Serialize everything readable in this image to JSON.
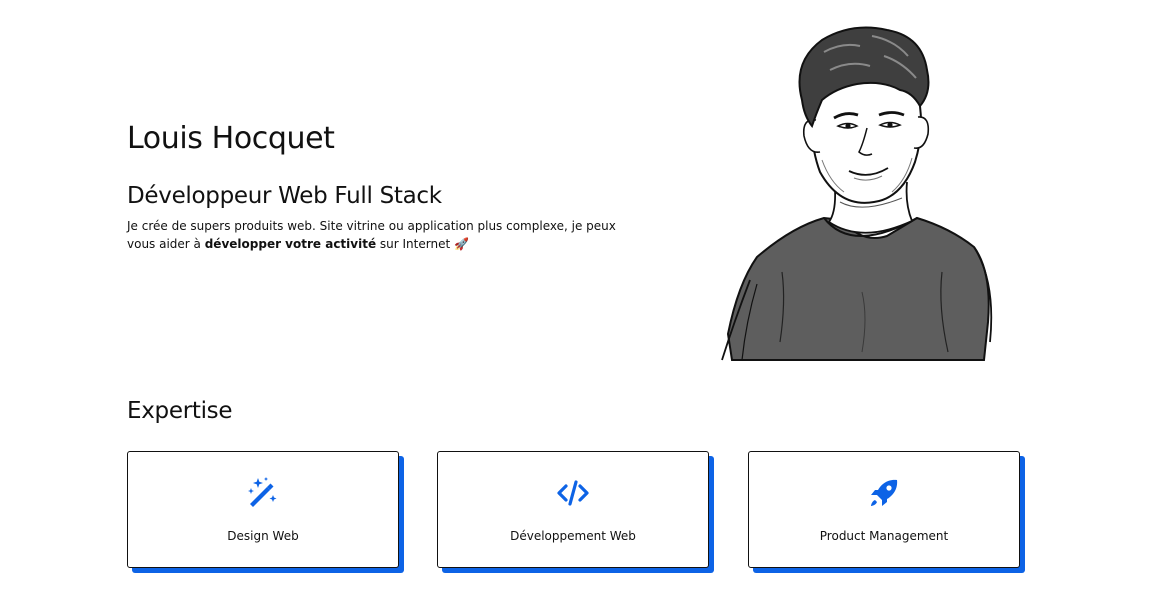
{
  "hero": {
    "name": "Louis Hocquet",
    "role": "Développeur Web Full Stack",
    "description_start": "Je crée de supers produits web. Site vitrine ou application plus complexe, je peux vous aider à ",
    "description_bold": "développer votre activité",
    "description_end": " sur Internet 🚀"
  },
  "expertise": {
    "title": "Expertise",
    "cards": [
      {
        "label": "Design Web",
        "icon": "magic-wand-icon"
      },
      {
        "label": "Développement Web",
        "icon": "code-icon"
      },
      {
        "label": "Product Management",
        "icon": "rocket-icon"
      }
    ]
  },
  "colors": {
    "accent": "#0d63e6",
    "text": "#111111",
    "background": "#ffffff"
  }
}
